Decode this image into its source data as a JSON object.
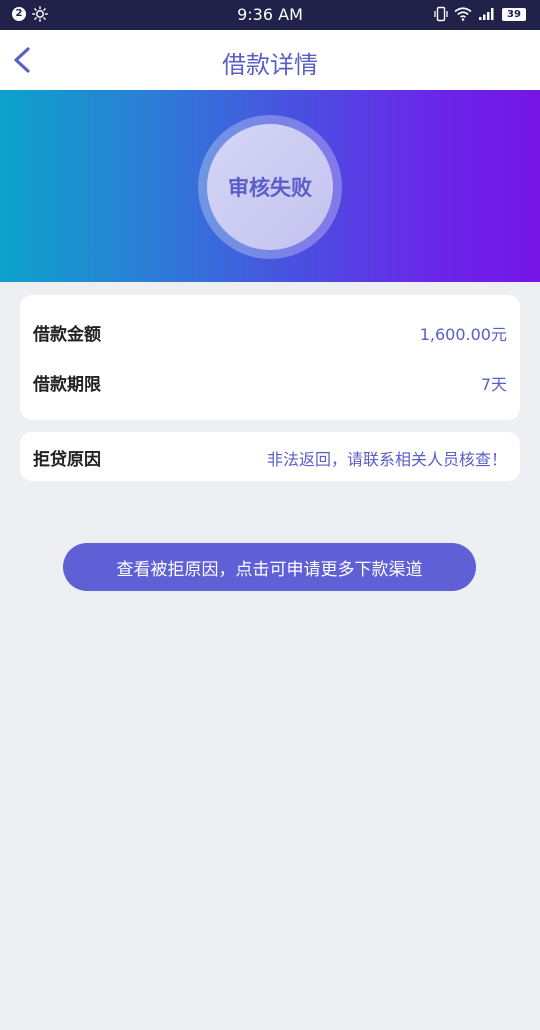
{
  "status_bar": {
    "notification_count": "2",
    "time": "9:36 AM",
    "battery": "39"
  },
  "nav": {
    "title": "借款详情"
  },
  "hero": {
    "status_text": "审核失败"
  },
  "loan_card": {
    "rows": [
      {
        "label": "借款金额",
        "value": "1,600.00元"
      },
      {
        "label": "借款期限",
        "value": "7天"
      }
    ]
  },
  "reason_card": {
    "label": "拒贷原因",
    "value": "非法返回，请联系相关人员核查！"
  },
  "action": {
    "label": "查看被拒原因，点击可申请更多下款渠道"
  },
  "colors": {
    "accent": "#5a5fc8",
    "status_bar_bg": "#20224a",
    "page_bg": "#eeeff3",
    "button_bg": "#5f5fd6"
  },
  "icons": [
    "notification-badge",
    "brightness-icon",
    "vibrate-icon",
    "wifi-icon",
    "signal-icon",
    "battery-icon",
    "back-arrow-icon"
  ]
}
